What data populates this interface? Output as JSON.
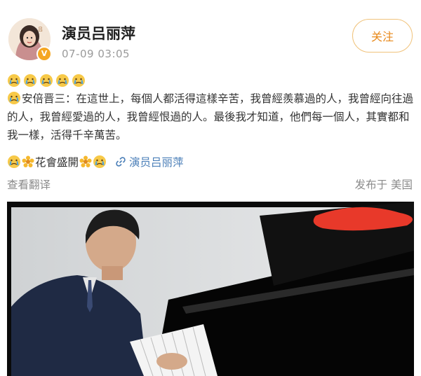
{
  "post": {
    "username": "演员吕丽萍",
    "timestamp": "07-09 03:05",
    "follow_label": "关注",
    "verified_icon": "verified-badge-icon",
    "crying_emoji_count": 5,
    "text": "安倍晋三：在這世上，每個人都活得這樣辛苦，我曾經羨慕過的人，我曾經向往過的人，我曾經愛過的人，我曾經恨過的人。最後我才知道，他們每一個人，其實都和我一樣，活得千辛萬苦。",
    "line3_text": "花會盛開",
    "link_text": "演员吕丽萍",
    "translate_label": "查看翻译",
    "location_label": "发布于 美国"
  },
  "colors": {
    "accent": "#e8891b",
    "link": "#4b7fb8",
    "muted": "#8a8a8a"
  }
}
